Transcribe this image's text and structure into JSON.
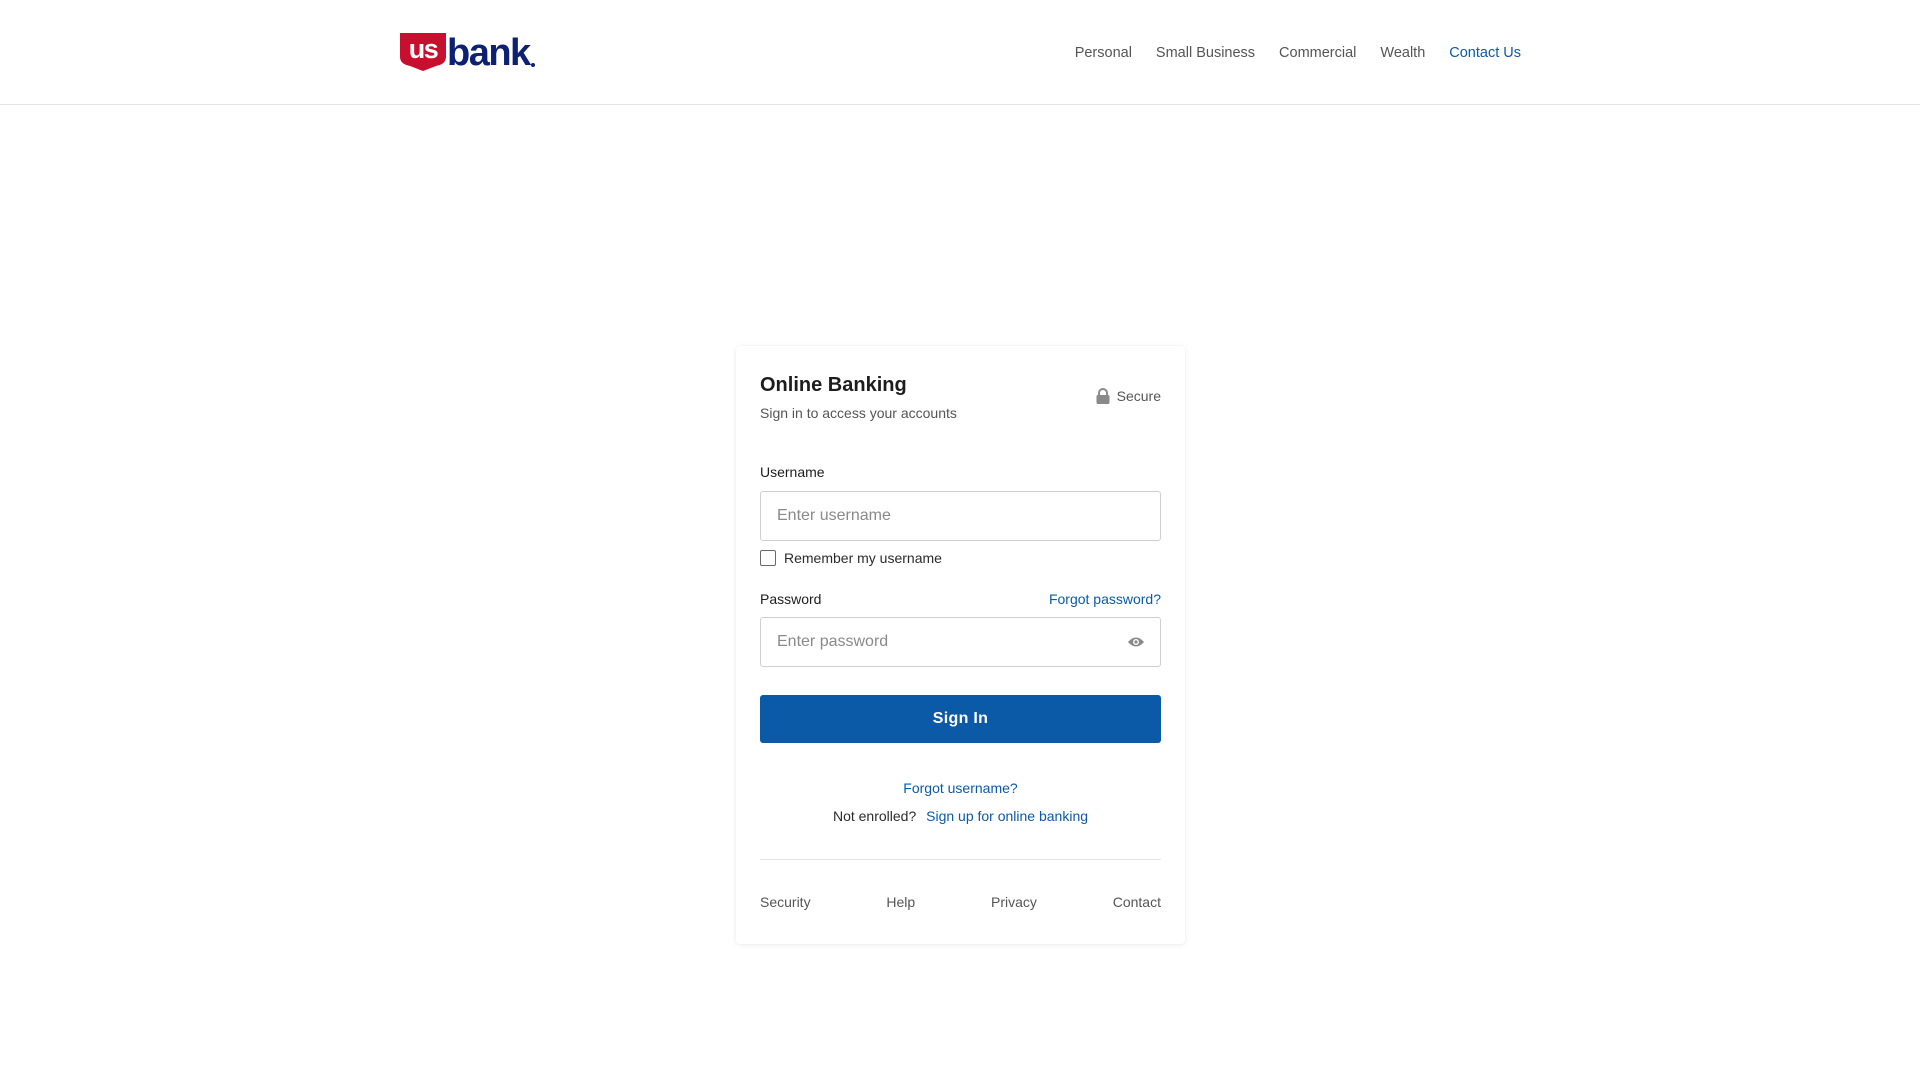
{
  "brand": {
    "logo_letters": "us",
    "logo_word": "bank",
    "primary_color": "#0b5aa8",
    "logo_red": "#c8102e",
    "logo_navy": "#0c2074"
  },
  "nav": {
    "items": [
      {
        "label": "Personal"
      },
      {
        "label": "Small Business"
      },
      {
        "label": "Commercial"
      },
      {
        "label": "Wealth"
      },
      {
        "label": "Contact Us"
      }
    ]
  },
  "login": {
    "title": "Online Banking",
    "subtitle": "Sign in to access your accounts",
    "secure_label": "Secure",
    "secure_icon": "lock-icon",
    "username_label": "Username",
    "username_placeholder": "Enter username",
    "username_value": "",
    "remember_label": "Remember my username",
    "remember_checked": false,
    "password_label": "Password",
    "forgot_password": "Forgot password?",
    "password_placeholder": "Enter password",
    "password_value": "",
    "show_password_icon": "eye-icon",
    "sign_in_label": "Sign In",
    "forgot_username": "Forgot username?",
    "not_enrolled": "Not enrolled?",
    "sign_up": "Sign up for online banking"
  },
  "footer": {
    "links": [
      {
        "label": "Security"
      },
      {
        "label": "Help"
      },
      {
        "label": "Privacy"
      },
      {
        "label": "Contact"
      }
    ]
  }
}
